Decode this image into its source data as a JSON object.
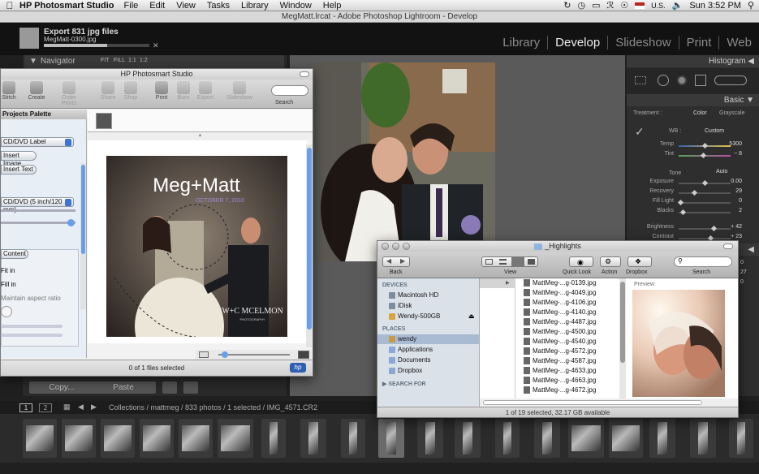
{
  "menubar": {
    "app": "HP Photosmart Studio",
    "items": [
      "File",
      "Edit",
      "View",
      "Tasks",
      "Library",
      "Window",
      "Help"
    ],
    "input_source": "U.S.",
    "clock": "Sun 3:52 PM"
  },
  "lightroom": {
    "window_title": "MegMatt.lrcat - Adobe Photoshop Lightroom - Develop",
    "export_title": "Export 831 jpg files",
    "export_file": "MegMatt-0300.jpg",
    "export_progress": 0.6,
    "modules": [
      "Library",
      "Develop",
      "Slideshow",
      "Print",
      "Web"
    ],
    "active_module": "Develop",
    "navigator": {
      "label": "Navigator",
      "zoom_options": [
        "FIT",
        "FILL",
        "1:1",
        "1:2"
      ]
    },
    "copy_label": "Copy...",
    "paste_label": "Paste",
    "filmstrip_path": "Collections / mattmeg / 833 photos / 1 selected / IMG_4571.CR2",
    "page_buttons": [
      "1",
      "2"
    ]
  },
  "right_panel": {
    "histogram": "Histogram",
    "basic": "Basic",
    "treatment_label": "Treatment :",
    "treatment_options": [
      "Color",
      "Grayscale"
    ],
    "wb_label": "WB :",
    "wb_value": "Custom",
    "tone_label": "Tone",
    "auto_label": "Auto",
    "sliders": [
      {
        "label": "Temp",
        "value": "5300",
        "pos": 0.5
      },
      {
        "label": "Tint",
        "value": "− 8",
        "pos": 0.46
      },
      {
        "label": "Exposure",
        "value": "0.00",
        "pos": 0.5
      },
      {
        "label": "Recovery",
        "value": "29",
        "pos": 0.28
      },
      {
        "label": "Fill Light",
        "value": "0",
        "pos": 0.0
      },
      {
        "label": "Blacks",
        "value": "2",
        "pos": 0.05
      },
      {
        "label": "Brightness",
        "value": "+ 42",
        "pos": 0.68
      },
      {
        "label": "Contrast",
        "value": "+ 23",
        "pos": 0.62
      }
    ],
    "extra_values": [
      "0",
      "27",
      "0"
    ]
  },
  "hp": {
    "title": "HP Photosmart Studio",
    "toolbar": [
      {
        "label": "Stitch",
        "enabled": true
      },
      {
        "label": "Create",
        "enabled": true
      },
      {
        "label": "Order Prints",
        "enabled": false
      },
      {
        "label": "Share",
        "enabled": false
      },
      {
        "label": "Shop",
        "enabled": false
      },
      {
        "label": "Print",
        "enabled": true
      },
      {
        "label": "Burn",
        "enabled": false
      },
      {
        "label": "Export",
        "enabled": false
      },
      {
        "label": "Slideshow",
        "enabled": false
      }
    ],
    "search_label": "Search",
    "palette_title": "Projects Palette",
    "palette_items": [
      "CD/DVD Label",
      "Insert Image",
      "Insert Text",
      "CD/DVD (5 inch/120 mm)",
      "Content",
      "Fit in",
      "Fill in",
      "Maintain aspect ratio"
    ],
    "photo_title": "Meg+Matt",
    "photo_date": "OCTOBER 7, 2010",
    "photo_credit": "W+C MCELMON",
    "photo_credit_sub": "PHOTOGRAPHY",
    "status": "0 of 1 files selected",
    "logo": "hp"
  },
  "finder": {
    "title": "_Highlights",
    "toolbar_labels": [
      "Back",
      "View",
      "Quick Look",
      "Action",
      "Dropbox",
      "Search"
    ],
    "devices_label": "DEVICES",
    "devices": [
      "Macintosh HD",
      "iDisk",
      "Wendy-500GB"
    ],
    "places_label": "PLACES",
    "places": [
      "wendy",
      "Applications",
      "Documents",
      "Dropbox"
    ],
    "search_for_label": "SEARCH FOR",
    "files": [
      "MattMeg-...g-0139.jpg",
      "MattMeg-...g-4049.jpg",
      "MattMeg-...g-4106.jpg",
      "MattMeg-...g-4140.jpg",
      "MattMeg-...g-4487.jpg",
      "MattMeg-...g-4500.jpg",
      "MattMeg-...g-4540.jpg",
      "MattMeg-...g-4572.jpg",
      "MattMeg-...g-4587.jpg",
      "MattMeg-...g-4633.jpg",
      "MattMeg-...g-4663.jpg",
      "MattMeg-...g-4672.jpg"
    ],
    "preview_label": "Preview:",
    "status": "1 of 19 selected, 32.17 GB available"
  }
}
